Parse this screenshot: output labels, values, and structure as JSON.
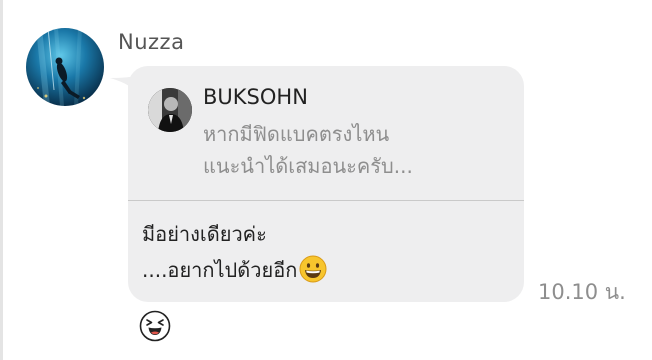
{
  "message": {
    "sender_name": "Nuzza",
    "avatar_icon": "diver-underwater-avatar",
    "quote": {
      "author": "BUKSOHN",
      "author_avatar_icon": "person-photo-avatar",
      "lines": [
        "หากมีฟิดแบคตรงไหน",
        "แนะนำได้เสมอนะครับ..."
      ]
    },
    "reply": {
      "lines": [
        "มีอย่างเดียวค่ะ",
        "....อยากไปด้วยอีก"
      ],
      "trailing_emoji": "grinning-face-emoji"
    },
    "timestamp": "10.10 น.",
    "reaction_icon": "laughing-sticker-icon"
  },
  "colors": {
    "bubble_bg": "#eeeeef",
    "name_text": "#555555",
    "quote_text": "#8e8e8e",
    "body_text": "#222222",
    "timestamp_text": "#8e8e8e",
    "emoji_yellow": "#f7c52d"
  }
}
